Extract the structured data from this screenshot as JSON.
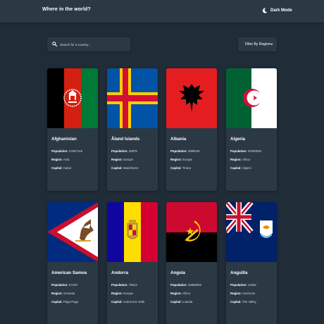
{
  "header": {
    "title": "Where in the world?",
    "dark_mode_label": "Dark Mode"
  },
  "search": {
    "placeholder": "Search for a country..."
  },
  "filter": {
    "label": "Filter By Region"
  },
  "labels": {
    "population": "Population:",
    "region": "Region:",
    "capital": "Capital:"
  },
  "countries": [
    {
      "name": "Afghanistan",
      "population": "27657145",
      "region": "Asia",
      "capital": "Kabul"
    },
    {
      "name": "Åland Islands",
      "population": "28875",
      "region": "Europe",
      "capital": "Mariehamn"
    },
    {
      "name": "Albania",
      "population": "2886026",
      "region": "Europe",
      "capital": "Tirana"
    },
    {
      "name": "Algeria",
      "population": "40400000",
      "region": "Africa",
      "capital": "Algiers"
    },
    {
      "name": "American Samoa",
      "population": "57100",
      "region": "Oceania",
      "capital": "Pago Pago"
    },
    {
      "name": "Andorra",
      "population": "78014",
      "region": "Europe",
      "capital": "Andorra la Vella"
    },
    {
      "name": "Angola",
      "population": "25868000",
      "region": "Africa",
      "capital": "Luanda"
    },
    {
      "name": "Anguilla",
      "population": "13452",
      "region": "Americas",
      "capital": "The Valley"
    }
  ],
  "colors": {
    "background": "#202c37",
    "element": "#2b3945",
    "text": "#ffffff"
  }
}
